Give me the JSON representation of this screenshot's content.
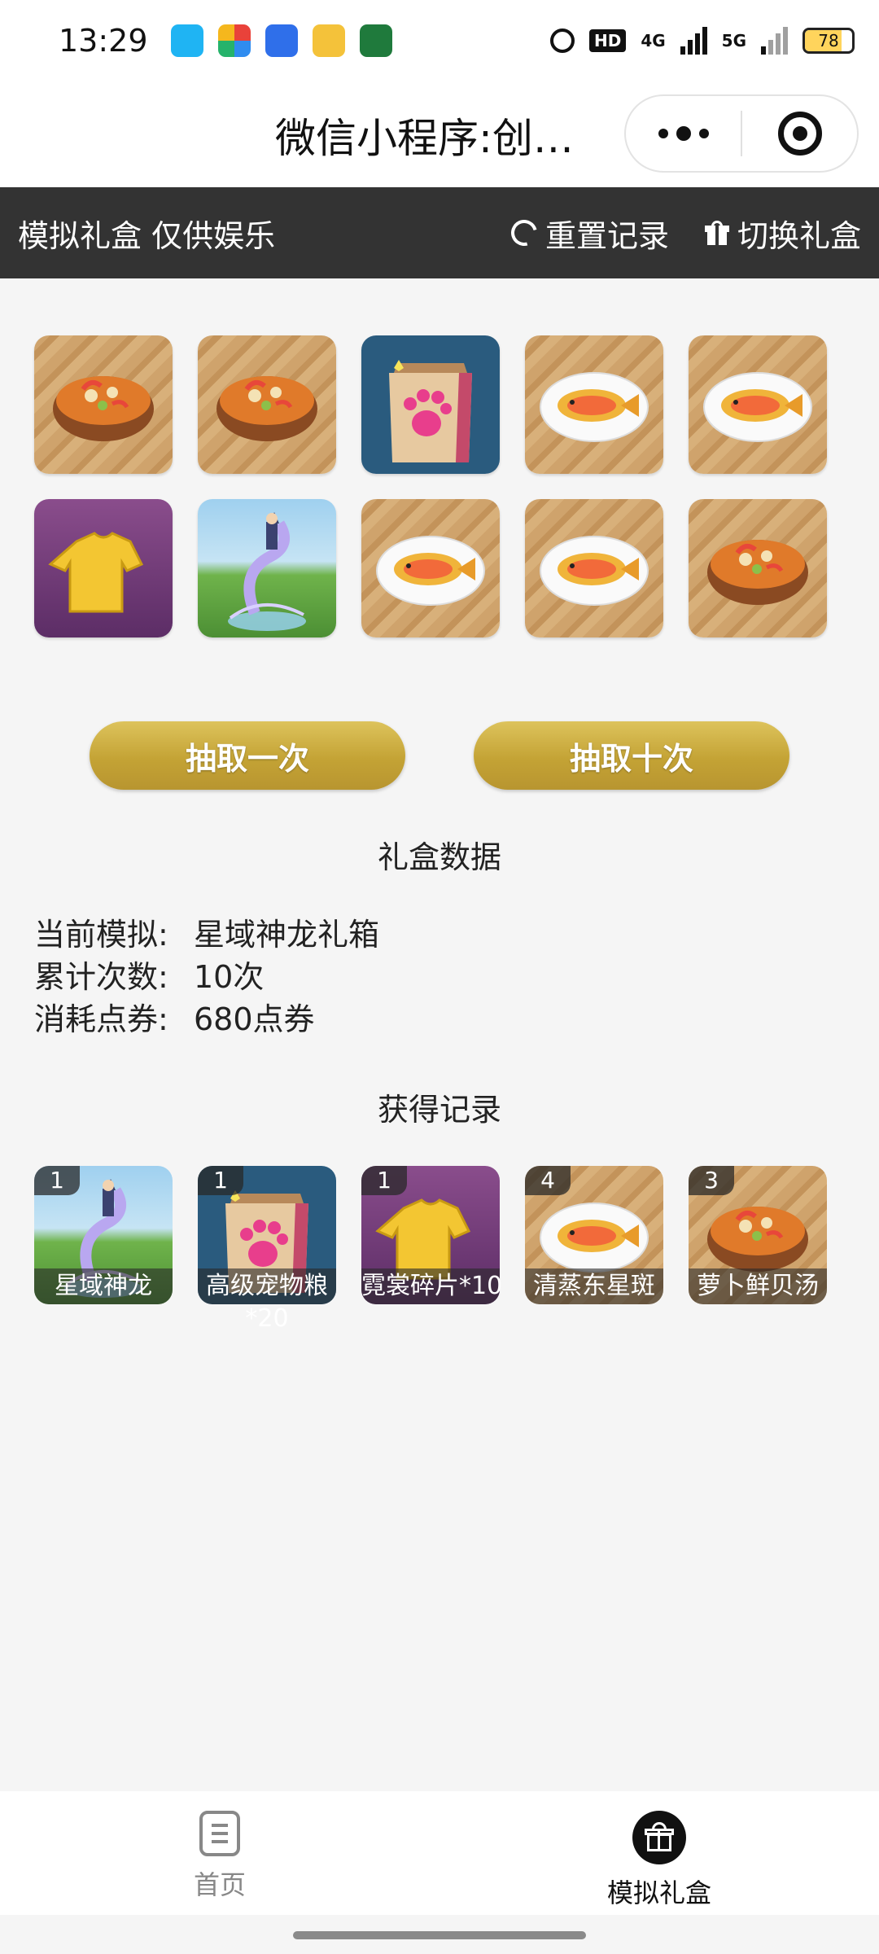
{
  "status_bar": {
    "time": "13:29",
    "hd_label": "HD",
    "net1_label": "4G",
    "net2_label": "5G",
    "battery": "78",
    "battery_level": 0.78,
    "app_icons": [
      "qq-icon",
      "pinwheel-icon",
      "blue-app-icon",
      "gold-diamond-icon",
      "oppo-icon"
    ]
  },
  "title_bar": {
    "title": "微信小程序:创魔宠物小..."
  },
  "header": {
    "title": "模拟礼盒 仅供娱乐",
    "reset_label": "重置记录",
    "switch_label": "切换礼盒"
  },
  "draws": [
    {
      "item": "soup"
    },
    {
      "item": "soup"
    },
    {
      "item": "pet-food-bag"
    },
    {
      "item": "fish-plate"
    },
    {
      "item": "fish-plate"
    },
    {
      "item": "shirt-shard"
    },
    {
      "item": "star-dragon"
    },
    {
      "item": "fish-plate"
    },
    {
      "item": "fish-plate"
    },
    {
      "item": "soup"
    }
  ],
  "actions": {
    "draw_once": "抽取一次",
    "draw_ten": "抽取十次"
  },
  "stats": {
    "section_title": "礼盒数据",
    "current_label": "当前模拟:",
    "current_value": "星域神龙礼箱",
    "count_label": "累计次数:",
    "count_value": "10次",
    "cost_label": "消耗点券:",
    "cost_value": "680点券"
  },
  "records": {
    "section_title": "获得记录",
    "items": [
      {
        "count": "1",
        "name": "星域神龙",
        "item": "star-dragon"
      },
      {
        "count": "1",
        "name": "高级宠物粮",
        "name_extra": "*20",
        "item": "pet-food-bag"
      },
      {
        "count": "1",
        "name": "霓裳碎片*10",
        "item": "shirt-shard"
      },
      {
        "count": "4",
        "name": "清蒸东星斑",
        "item": "fish-plate"
      },
      {
        "count": "3",
        "name": "萝卜鲜贝汤",
        "item": "soup"
      }
    ]
  },
  "tabbar": {
    "home": "首页",
    "gift": "模拟礼盒",
    "active": "gift"
  },
  "colors": {
    "header_bg": "#333333",
    "button_gold": "#c4a335",
    "page_bg": "#f5f5f5"
  }
}
